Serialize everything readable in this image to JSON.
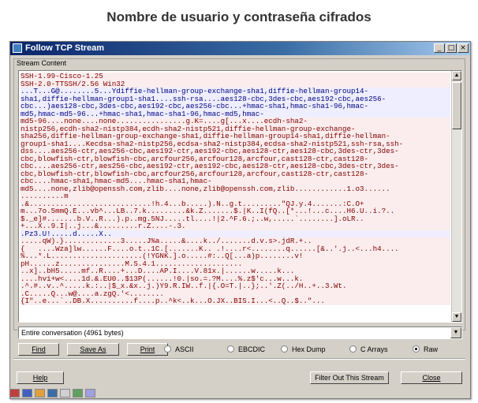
{
  "page_title": "Nombre de usuario y contraseña cifrados",
  "window": {
    "title": "Follow TCP Stream",
    "controls": {
      "minimize": "_",
      "maximize": "□",
      "close": "×"
    }
  },
  "stream_label": "Stream Content",
  "stream_lines": [
    {
      "text": "SSH-1.99-Cisco-1.25",
      "kind": "server"
    },
    {
      "text": "SSH-2.0-TTSSH/2.56 Win32",
      "kind": "server"
    },
    {
      "text": "...T...G@........5...Ydiffie-hellman-group-exchange-sha1,diffie-hellman-group14-",
      "kind": "client"
    },
    {
      "text": "sha1,diffie-hellman-group1-sha1....ssh-rsa....aes128-cbc,3des-cbc,aes192-cbc,aes256-",
      "kind": "client"
    },
    {
      "text": "cbc...)aes128-cbc,3des-cbc,aes192-cbc,aes256-cbc...+hmac-sha1,hmac-sha1-96,hmac-",
      "kind": "client"
    },
    {
      "text": "md5,hmac-md5-96...+hmac-sha1,hmac-sha1-96,hmac-md5,hmac-",
      "kind": "client"
    },
    {
      "text": "md5-96....none....none................g.K=....g[...x....ecdh-sha2-",
      "kind": "server"
    },
    {
      "text": "nistp256,ecdh-sha2-nistp384,ecdh-sha2-nistp521,diffie-hellman-group-exchange-",
      "kind": "server"
    },
    {
      "text": "sha256,diffie-hellman-group-exchange-sha1,diffie-hellman-group14-sha1,diffie-hellman-",
      "kind": "server"
    },
    {
      "text": "group1-sha1....Kecdsa-sha2-nistp256,ecdsa-sha2-nistp384,ecdsa-sha2-nistp521,ssh-rsa,ssh-",
      "kind": "server"
    },
    {
      "text": "dss....aes256-ctr,aes256-cbc,aes192-ctr,aes192-cbc,aes128-ctr,aes128-cbc,3des-ctr,3des-",
      "kind": "server"
    },
    {
      "text": "cbc,blowfish-ctr,blowfish-cbc,arcfour256,arcfour128,arcfour,cast128-ctr,cast128-",
      "kind": "server"
    },
    {
      "text": "cbc....aes256-ctr,aes256-cbc,aes192-ctr,aes192-cbc,aes128-ctr,aes128-cbc,3des-ctr,3des-",
      "kind": "server"
    },
    {
      "text": "cbc,blowfish-ctr,blowfish-cbc,arcfour256,arcfour128,arcfour,cast128-ctr,cast128-",
      "kind": "server"
    },
    {
      "text": "cbc....hmac-sha1,hmac-md5....hmac-sha1,hmac-",
      "kind": "server"
    },
    {
      "text": "md5....none,zlib@openssh.com,zlib....none,zlib@openssh.com,zlib............1.o3......",
      "kind": "server"
    },
    {
      "text": "..........m",
      "kind": "server"
    },
    {
      "text": ".&............................!h.4...b.....).N..g.t.........\"QJ.y.4.......:C.O+",
      "kind": "server"
    },
    {
      "text": "m...7o.5mmQ.E...vb^...LB..7.k.........&k.Z.......$.|K..I(fQ..[*...!...c....H6.U..i.?..",
      "kind": "server"
    },
    {
      "text": "$._e]#.......b.V..R...).p..mg.5NJ.....tl....!|2.^F.6.;..w,.....`........].oLR..",
      "kind": "server"
    },
    {
      "text": "+...X..9.I|..j...&.........r.Z....-.3.",
      "kind": "server"
    },
    {
      "text": ".Pz3.U!.....d.....X..",
      "kind": "client"
    },
    {
      "text": ".....qW).}.............3.....J%a.....&....k../.......d.v.s>.jdR.+..",
      "kind": "server"
    },
    {
      "text": "{   ....Wza]lw......F....o.t..1C.[.......K.. .!....r<........q......[&..'.j..<...h4....",
      "kind": "server"
    },
    {
      "text": "%...*.L.....................(!YGNK.].o.....#:..Q[...a)p........v!",
      "kind": "server"
    },
    {
      "text": "pH......z...............M.S.4.1....................",
      "kind": "server"
    },
    {
      "text": "..x]..bH5.....mf..R....+...D....AP.I....V.81x.|......w.....k...",
      "kind": "server"
    },
    {
      "text": "....hvi+w<....1d.&.EU0..$13P(......!0.|so.=.?M....%.z$'c...w...k.",
      "kind": "server"
    },
    {
      "text": ".^.#..v..^.....k.:..|$_x.&x..j.)Y9.R.IW..f.|{.O=T.|..};..'.Z(../H..+..3.Wt.",
      "kind": "server"
    },
    {
      "text": ".C.....Q...w@....a.zgQ.'<........",
      "kind": "server"
    },
    {
      "text": "{I\"..e...`..DB.X..........f....p..^k<..k...O.JX..BIS.I...<..Q..$..\"...",
      "kind": "server"
    }
  ],
  "conversation_select": "Entire conversation (4961 bytes)",
  "buttons": {
    "find": "Find",
    "save_as": "Save As",
    "print": "Print",
    "help": "Help",
    "filter_out": "Filter Out This Stream",
    "close": "Close"
  },
  "radio_options": [
    {
      "label": "ASCII",
      "selected": false
    },
    {
      "label": "EBCDIC",
      "selected": false
    },
    {
      "label": "Hex Dump",
      "selected": false
    },
    {
      "label": "C Arrays",
      "selected": false
    },
    {
      "label": "Raw",
      "selected": true
    }
  ],
  "colors": {
    "client_text": "#00007f",
    "client_bg": "#eeeeff",
    "server_text": "#7f0000",
    "server_bg": "#fbeded",
    "titlebar": "#0a246a"
  }
}
